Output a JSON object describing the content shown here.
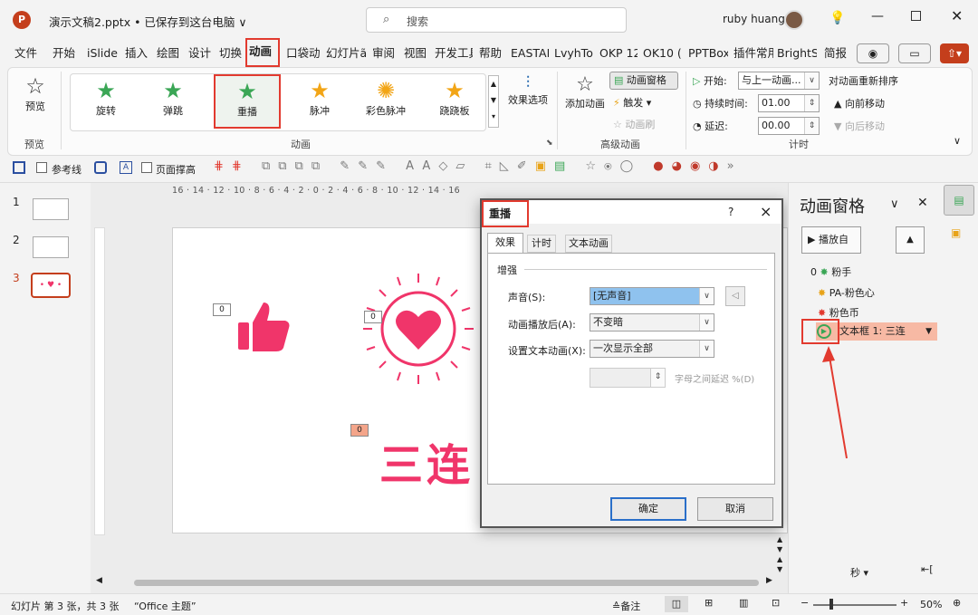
{
  "title_bar": {
    "doc_title": "演示文稿2.pptx • 已保存到这台电脑 ∨",
    "search_placeholder": "搜索",
    "user_name": "ruby huang",
    "colors": {
      "brand": "#c43e1c",
      "accent_red": "#e23a2f",
      "pink": "#f0356a"
    }
  },
  "ribbon_tabs": [
    "文件",
    "开始",
    "iSlide",
    "插入",
    "绘图",
    "设计",
    "切换",
    "动画",
    "口袋动",
    "幻灯片ã",
    "审阅",
    "视图",
    "开发工具",
    "帮助",
    "EASTAI",
    "LvyhTo",
    "OKP 12",
    "OK10 (",
    "PPTBox",
    "插件常用",
    "BrightS",
    "简报"
  ],
  "active_tab": "动画",
  "ribbon": {
    "preview_label": "预览",
    "preview_group": "预览",
    "effects": [
      {
        "label": "旋转",
        "icon": "star-spin-icon"
      },
      {
        "label": "弹跳",
        "icon": "star-bounce-icon"
      },
      {
        "label": "重播",
        "icon": "star-replay-icon"
      },
      {
        "label": "脉冲",
        "icon": "star-pulse-icon"
      },
      {
        "label": "彩色脉冲",
        "icon": "star-color-pulse-icon"
      },
      {
        "label": "跷跷板",
        "icon": "star-teeter-icon"
      }
    ],
    "selected_effect": "重播",
    "effect_options": "效果选项",
    "animation_group": "动画",
    "add_animation": "添加动画",
    "anim_pane_btn": "动画窗格",
    "trigger": "触发 ▾",
    "anim_painter": "动画刷",
    "adv_group": "高级动画",
    "start_label": "开始:",
    "start_value": "与上一动画...",
    "duration_label": "持续时间:",
    "duration_value": "01.00",
    "delay_label": "延迟:",
    "delay_value": "00.00",
    "reorder_title": "对动画重新排序",
    "move_earlier": "向前移动",
    "move_later": "向后移动",
    "timing_group": "计时"
  },
  "qat": {
    "guides": "参考线",
    "page_fit": "页面撑高"
  },
  "thumbnails": [
    {
      "num": "1"
    },
    {
      "num": "2"
    },
    {
      "num": "3"
    }
  ],
  "ruler": "16 · 14 · 12 · 10 · 8 · 6 · 4 · 2 · 0 · 2 · 4 · 6 · 8 · 10 · 12 · 14 · 16",
  "slide": {
    "tag_thumb": "0",
    "tag_heart": "0",
    "tag_text": "0",
    "text": "三连"
  },
  "dialog": {
    "title": "重播",
    "help": "?",
    "close": "×",
    "tabs": [
      "效果",
      "计时",
      "文本动画"
    ],
    "section": "增强",
    "sound_label": "声音(S):",
    "sound_value": "[无声音]",
    "after_label": "动画播放后(A):",
    "after_value": "不变暗",
    "text_label": "设置文本动画(X):",
    "text_value": "一次显示全部",
    "delay_suffix": "字母之间延迟 %(D)",
    "ok": "确定",
    "cancel": "取消"
  },
  "anim_pane": {
    "title": "动画窗格",
    "play_from": "播放自",
    "items": [
      {
        "index": "0",
        "label": "粉手",
        "icon": "burst-green-icon"
      },
      {
        "index": "",
        "label": "PA-粉色心",
        "icon": "burst-orange-icon"
      },
      {
        "index": "",
        "label": "粉色币",
        "icon": "burst-red-icon"
      },
      {
        "index": "",
        "label": "文本框 1: 三连",
        "icon": "replay-circle-icon"
      }
    ],
    "seconds": "秒 ▾"
  },
  "status": {
    "slide_info": "幻灯片 第 3 张，共 3 张",
    "theme": "“Office 主题”",
    "notes": "≙备注",
    "zoom": "50%"
  }
}
